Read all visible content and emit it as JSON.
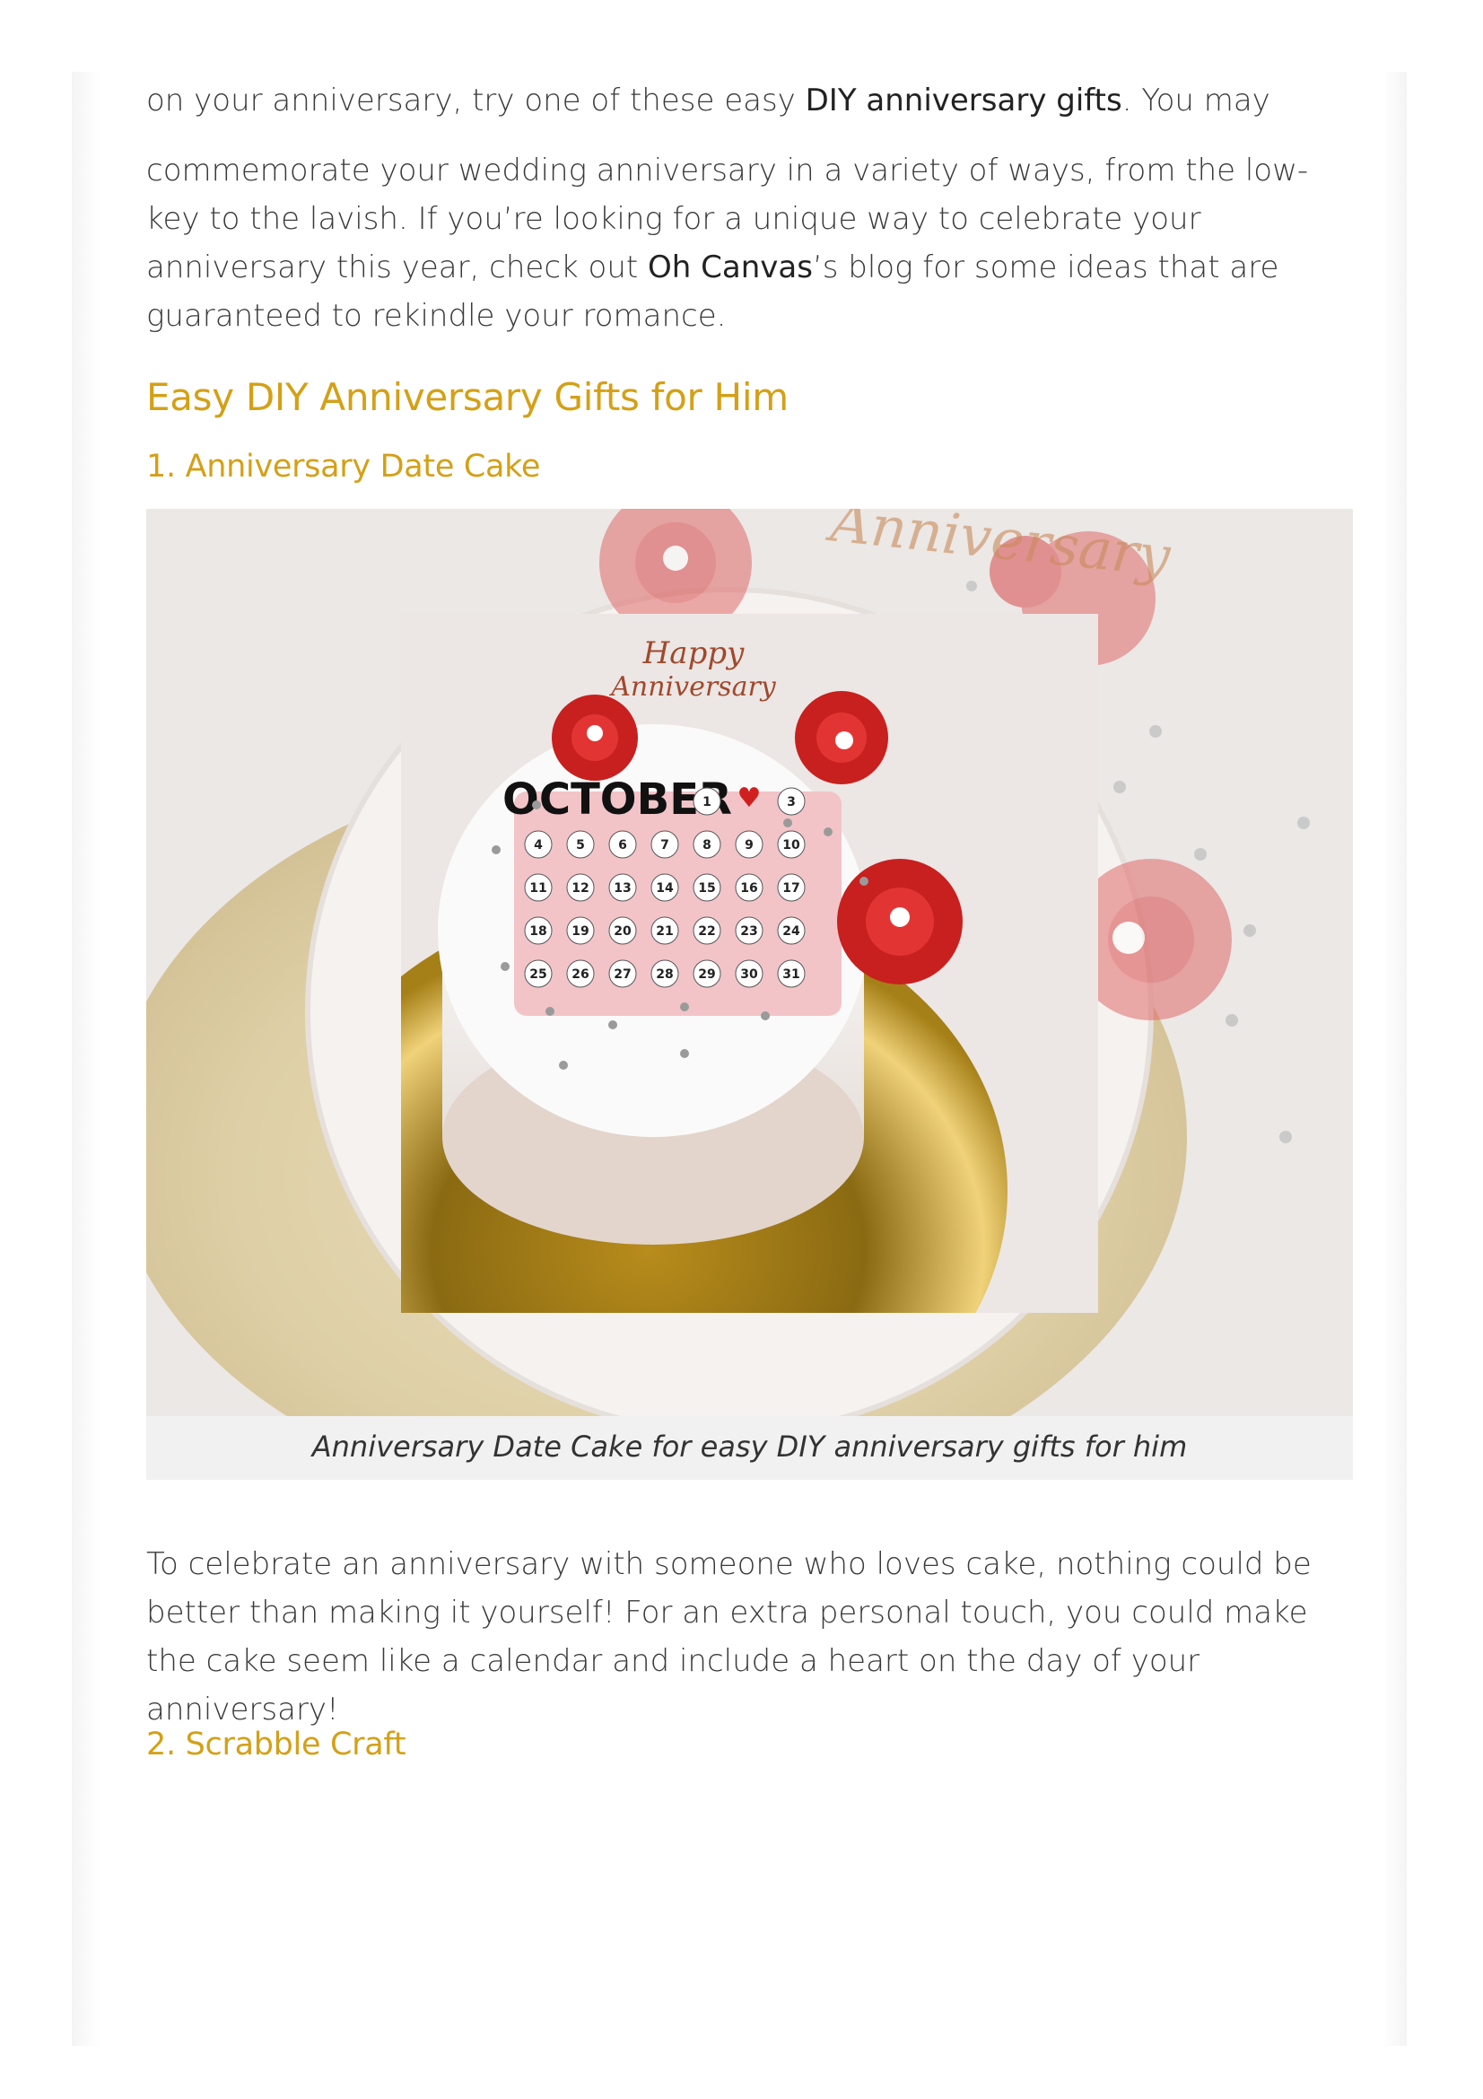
{
  "article": {
    "intro_line": {
      "before": "on your anniversary, try one of these easy ",
      "link": "DIY anniversary gifts",
      "after": ". You may"
    },
    "intro_para": {
      "before": "commemorate your wedding anniversary in a variety of ways, from the low-key to the lavish. If you’re looking for a unique way to celebrate your anniversary this year, check out ",
      "brand": "Oh Canvas",
      "after": "’s blog for some ideas that are guaranteed to rekindle your romance."
    },
    "section_heading": "Easy DIY Anniversary Gifts for Him",
    "item1": {
      "heading": "1. Anniversary Date Cake",
      "image": {
        "topper_text_top": "Happy",
        "topper_text_bottom": "Anniversary",
        "month_label": "OCTOBER",
        "calendar_rows": [
          [
            "",
            "",
            "",
            "",
            "1",
            "♥",
            "3"
          ],
          [
            "4",
            "5",
            "6",
            "7",
            "8",
            "9",
            "10"
          ],
          [
            "11",
            "12",
            "13",
            "14",
            "15",
            "16",
            "17"
          ],
          [
            "18",
            "19",
            "20",
            "21",
            "22",
            "23",
            "24"
          ],
          [
            "25",
            "26",
            "27",
            "28",
            "29",
            "30",
            "31"
          ]
        ]
      },
      "caption": "Anniversary Date Cake for easy DIY anniversary gifts for him",
      "body": "To celebrate an anniversary with someone who loves cake, nothing could be better than making it yourself! For an extra personal touch, you could make the cake seem like a calendar and include a heart on the day of your anniversary!"
    },
    "item2": {
      "heading": "2. Scrabble Craft"
    }
  },
  "colors": {
    "heading_gold": "#d4a017",
    "body_text": "#3a3a3a",
    "caption_bg": "#f1f1f1"
  }
}
